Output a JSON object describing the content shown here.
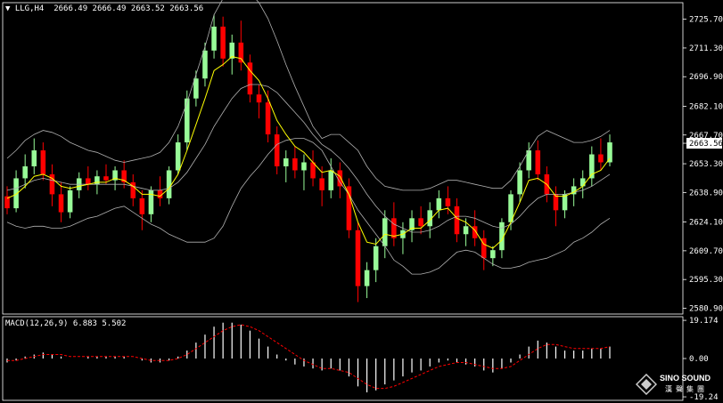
{
  "main_header": {
    "marker": "▼",
    "symbol": "LLG,H4",
    "ohlc": "2666.49 2666.49 2663.52 2663.56"
  },
  "macd_header": {
    "label": "MACD(12,26,9) 6.883 5.502"
  },
  "logo": {
    "name": "SINO SOUND",
    "sub": "漢聲集團"
  },
  "colors": {
    "background": "#000000",
    "bull": "#98FB98",
    "bear": "#FF0000",
    "bands": "#B0B0B0",
    "ma": "#FFFF00",
    "signal": "#FF0000",
    "histogram": "#FFFFFF",
    "grid": "#FFFFFF"
  },
  "chart_data": [
    {
      "type": "candlestick",
      "symbol": "LLG",
      "timeframe": "H4",
      "price_axis_ticks": [
        "2725.70",
        "2711.30",
        "2696.90",
        "2682.10",
        "2667.70",
        "2653.30",
        "2638.90",
        "2624.10",
        "2609.70",
        "2595.30",
        "2580.90"
      ],
      "current_price": "2663.56",
      "ylim": [
        2578,
        2734
      ],
      "indicators": [
        "Bollinger Bands",
        "Moving Average"
      ],
      "candles": [
        [
          2637,
          2642,
          2628,
          2631
        ],
        [
          2631,
          2650,
          2629,
          2646
        ],
        [
          2646,
          2658,
          2641,
          2652
        ],
        [
          2652,
          2666,
          2648,
          2660
        ],
        [
          2660,
          2664,
          2645,
          2648
        ],
        [
          2648,
          2653,
          2632,
          2638
        ],
        [
          2638,
          2644,
          2624,
          2629
        ],
        [
          2629,
          2642,
          2626,
          2640
        ],
        [
          2640,
          2649,
          2636,
          2646
        ],
        [
          2646,
          2652,
          2640,
          2643
        ],
        [
          2643,
          2650,
          2638,
          2647
        ],
        [
          2647,
          2653,
          2643,
          2645
        ],
        [
          2645,
          2652,
          2640,
          2650
        ],
        [
          2650,
          2655,
          2641,
          2644
        ],
        [
          2644,
          2648,
          2632,
          2636
        ],
        [
          2636,
          2640,
          2620,
          2628
        ],
        [
          2628,
          2642,
          2624,
          2640
        ],
        [
          2640,
          2647,
          2632,
          2636
        ],
        [
          2636,
          2652,
          2633,
          2650
        ],
        [
          2650,
          2668,
          2648,
          2664
        ],
        [
          2664,
          2690,
          2660,
          2686
        ],
        [
          2686,
          2700,
          2682,
          2696
        ],
        [
          2696,
          2714,
          2692,
          2710
        ],
        [
          2710,
          2728,
          2706,
          2722
        ],
        [
          2722,
          2727,
          2702,
          2706
        ],
        [
          2706,
          2718,
          2698,
          2714
        ],
        [
          2714,
          2725,
          2700,
          2704
        ],
        [
          2704,
          2708,
          2684,
          2688
        ],
        [
          2688,
          2693,
          2676,
          2684
        ],
        [
          2684,
          2690,
          2664,
          2668
        ],
        [
          2668,
          2672,
          2648,
          2652
        ],
        [
          2652,
          2660,
          2644,
          2656
        ],
        [
          2656,
          2662,
          2646,
          2650
        ],
        [
          2650,
          2658,
          2640,
          2654
        ],
        [
          2654,
          2660,
          2642,
          2646
        ],
        [
          2646,
          2652,
          2632,
          2640
        ],
        [
          2640,
          2656,
          2636,
          2650
        ],
        [
          2650,
          2654,
          2636,
          2642
        ],
        [
          2642,
          2646,
          2616,
          2620
        ],
        [
          2620,
          2624,
          2584,
          2592
        ],
        [
          2592,
          2604,
          2586,
          2600
        ],
        [
          2600,
          2616,
          2594,
          2612
        ],
        [
          2612,
          2630,
          2606,
          2626
        ],
        [
          2626,
          2634,
          2612,
          2616
        ],
        [
          2616,
          2624,
          2608,
          2620
        ],
        [
          2620,
          2630,
          2614,
          2626
        ],
        [
          2626,
          2632,
          2618,
          2622
        ],
        [
          2622,
          2634,
          2616,
          2630
        ],
        [
          2630,
          2640,
          2626,
          2636
        ],
        [
          2636,
          2642,
          2628,
          2632
        ],
        [
          2632,
          2636,
          2614,
          2618
        ],
        [
          2618,
          2626,
          2612,
          2622
        ],
        [
          2622,
          2630,
          2612,
          2616
        ],
        [
          2616,
          2620,
          2600,
          2606
        ],
        [
          2606,
          2612,
          2602,
          2610
        ],
        [
          2610,
          2626,
          2606,
          2624
        ],
        [
          2624,
          2640,
          2620,
          2638
        ],
        [
          2638,
          2654,
          2634,
          2650
        ],
        [
          2650,
          2664,
          2646,
          2660
        ],
        [
          2660,
          2665,
          2645,
          2648
        ],
        [
          2648,
          2652,
          2634,
          2638
        ],
        [
          2638,
          2642,
          2622,
          2630
        ],
        [
          2630,
          2640,
          2626,
          2638
        ],
        [
          2638,
          2646,
          2632,
          2642
        ],
        [
          2642,
          2650,
          2636,
          2646
        ],
        [
          2646,
          2662,
          2642,
          2658
        ],
        [
          2658,
          2666,
          2650,
          2654
        ],
        [
          2654,
          2668,
          2652,
          2664
        ]
      ],
      "bollinger_upper": [
        2656,
        2660,
        2665,
        2668,
        2670,
        2669,
        2667,
        2664,
        2662,
        2660,
        2659,
        2657,
        2655,
        2654,
        2655,
        2656,
        2657,
        2659,
        2664,
        2672,
        2684,
        2698,
        2712,
        2728,
        2736,
        2740,
        2741,
        2739,
        2734,
        2726,
        2715,
        2703,
        2692,
        2682,
        2672,
        2666,
        2668,
        2668,
        2664,
        2660,
        2652,
        2646,
        2642,
        2641,
        2640,
        2640,
        2640,
        2641,
        2643,
        2645,
        2645,
        2644,
        2643,
        2642,
        2641,
        2641,
        2645,
        2652,
        2660,
        2667,
        2670,
        2668,
        2666,
        2664,
        2664,
        2665,
        2667,
        2670
      ],
      "bollinger_middle": [
        2640,
        2641,
        2643,
        2645,
        2646,
        2645,
        2644,
        2643,
        2643,
        2643,
        2643,
        2643,
        2643,
        2643,
        2642,
        2641,
        2640,
        2640,
        2641,
        2644,
        2649,
        2656,
        2663,
        2672,
        2679,
        2686,
        2691,
        2693,
        2693,
        2692,
        2689,
        2684,
        2679,
        2674,
        2668,
        2663,
        2660,
        2656,
        2651,
        2645,
        2638,
        2632,
        2627,
        2623,
        2621,
        2619,
        2619,
        2620,
        2622,
        2625,
        2627,
        2627,
        2626,
        2624,
        2622,
        2621,
        2623,
        2627,
        2632,
        2636,
        2638,
        2638,
        2638,
        2639,
        2640,
        2642,
        2645,
        2648
      ],
      "bollinger_lower": [
        2624,
        2622,
        2621,
        2622,
        2622,
        2621,
        2621,
        2622,
        2624,
        2626,
        2627,
        2629,
        2631,
        2632,
        2629,
        2626,
        2623,
        2621,
        2618,
        2616,
        2614,
        2614,
        2614,
        2616,
        2622,
        2632,
        2641,
        2647,
        2652,
        2658,
        2663,
        2665,
        2666,
        2666,
        2664,
        2660,
        2652,
        2644,
        2638,
        2630,
        2624,
        2618,
        2612,
        2605,
        2602,
        2598,
        2598,
        2599,
        2601,
        2605,
        2609,
        2610,
        2609,
        2606,
        2603,
        2601,
        2601,
        2602,
        2604,
        2605,
        2606,
        2608,
        2610,
        2614,
        2616,
        2619,
        2623,
        2626
      ],
      "moving_average": [
        2636,
        2638,
        2642,
        2647,
        2648,
        2646,
        2642,
        2641,
        2642,
        2643,
        2644,
        2644,
        2646,
        2645,
        2642,
        2638,
        2638,
        2637,
        2641,
        2648,
        2660,
        2673,
        2686,
        2700,
        2703,
        2707,
        2706,
        2700,
        2695,
        2686,
        2675,
        2668,
        2662,
        2659,
        2654,
        2649,
        2650,
        2647,
        2638,
        2624,
        2614,
        2613,
        2618,
        2617,
        2618,
        2621,
        2621,
        2625,
        2630,
        2631,
        2626,
        2624,
        2620,
        2613,
        2611,
        2615,
        2624,
        2634,
        2645,
        2646,
        2643,
        2637,
        2637,
        2639,
        2642,
        2648,
        2650,
        2656
      ]
    },
    {
      "type": "macd",
      "label": "MACD(12,26,9)",
      "macd_value": 6.883,
      "signal_value": 5.502,
      "axis_ticks": [
        "19.174",
        "0.00",
        "-19.24"
      ],
      "ylim": [
        -21,
        21
      ],
      "histogram": [
        -2,
        -1,
        1,
        2,
        3,
        2,
        1,
        0,
        0,
        1,
        1,
        1,
        1,
        1,
        0,
        -1,
        -2,
        -2,
        -1,
        1,
        4,
        8,
        12,
        16,
        18,
        18,
        17,
        14,
        10,
        6,
        2,
        -1,
        -3,
        -4,
        -5,
        -6,
        -5,
        -6,
        -9,
        -14,
        -17,
        -16,
        -13,
        -11,
        -9,
        -7,
        -6,
        -4,
        -2,
        -1,
        -2,
        -3,
        -4,
        -6,
        -7,
        -5,
        -2,
        2,
        6,
        9,
        8,
        6,
        4,
        4,
        4,
        5,
        5,
        6
      ],
      "signal": [
        -1,
        -1,
        0,
        1,
        2,
        2,
        2,
        1,
        1,
        1,
        1,
        1,
        1,
        1,
        1,
        0,
        -1,
        -1,
        -1,
        0,
        2,
        5,
        8,
        11,
        14,
        16,
        17,
        16,
        14,
        11,
        8,
        5,
        2,
        -1,
        -3,
        -5,
        -5,
        -6,
        -7,
        -10,
        -13,
        -15,
        -15,
        -14,
        -12,
        -10,
        -8,
        -6,
        -4,
        -3,
        -2,
        -2,
        -3,
        -4,
        -5,
        -5,
        -4,
        -1,
        2,
        5,
        7,
        7,
        6,
        5,
        5,
        5,
        5,
        6
      ]
    }
  ]
}
